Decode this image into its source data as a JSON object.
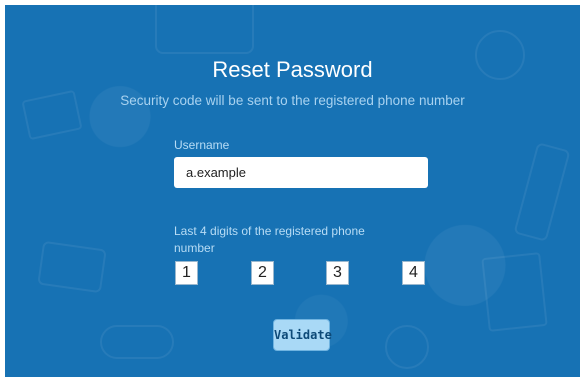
{
  "header": {
    "title": "Reset Password",
    "subtitle": "Security code will be sent to the registered phone number"
  },
  "form": {
    "username_label": "Username",
    "username_value": "a.example",
    "digits_label": "Last 4 digits of the registered phone number",
    "digits": [
      "1",
      "2",
      "3",
      "4"
    ],
    "validate_label": "Validate"
  },
  "colors": {
    "background": "#1772b4",
    "button": "#a9d9f6",
    "label": "#b7dcf5"
  }
}
